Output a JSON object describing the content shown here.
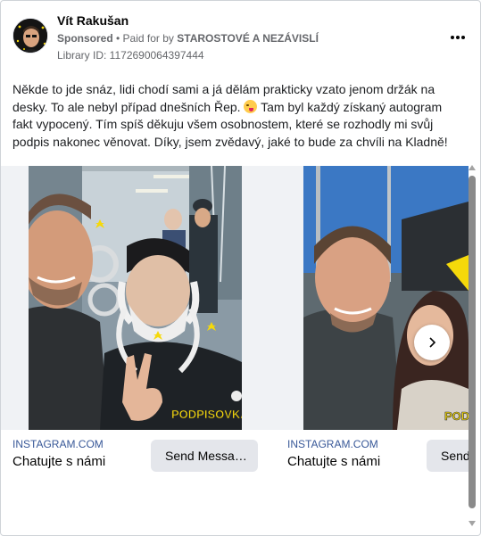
{
  "post": {
    "author": "Vít Rakušan",
    "sponsored": "Sponsored",
    "paid_prefix": " • Paid for by ",
    "paid_by": "STAROSTOVÉ A NEZÁVISLÍ",
    "library_id": "Library ID: 1172690064397444",
    "text_part1": "Někde to jde snáz, lidi chodí sami a já dělám prakticky vzato jenom držák na desky. To ale nebyl případ dnešních Řep. ",
    "text_part2": " Tam byl každý získaný autogram fakt vypocený. Tím spíš děkuju všem osobnostem, které se rozhodly mi svůj podpis nakonec věnovat. Díky, jsem zvědavý, jaké to bude za chvíli na Kladně!",
    "emoji": "face-with-tongue-emoji",
    "more_icon": "more-options-icon"
  },
  "carousel": {
    "cards": [
      {
        "domain": "INSTAGRAM.COM",
        "headline": "Chatujte s námi",
        "button": "Send Messa…",
        "sticker": "PODPISOVKA"
      },
      {
        "domain": "INSTAGRAM.COM",
        "headline": "Chatujte s námi",
        "button": "Send",
        "sticker": "PODPISOVKA"
      }
    ],
    "next_icon": "chevron-right-icon"
  },
  "colors": {
    "link": "#385898",
    "button_bg": "#e4e6eb",
    "secondary_text": "#65676b",
    "sticker_yellow": "#f5d90a"
  }
}
